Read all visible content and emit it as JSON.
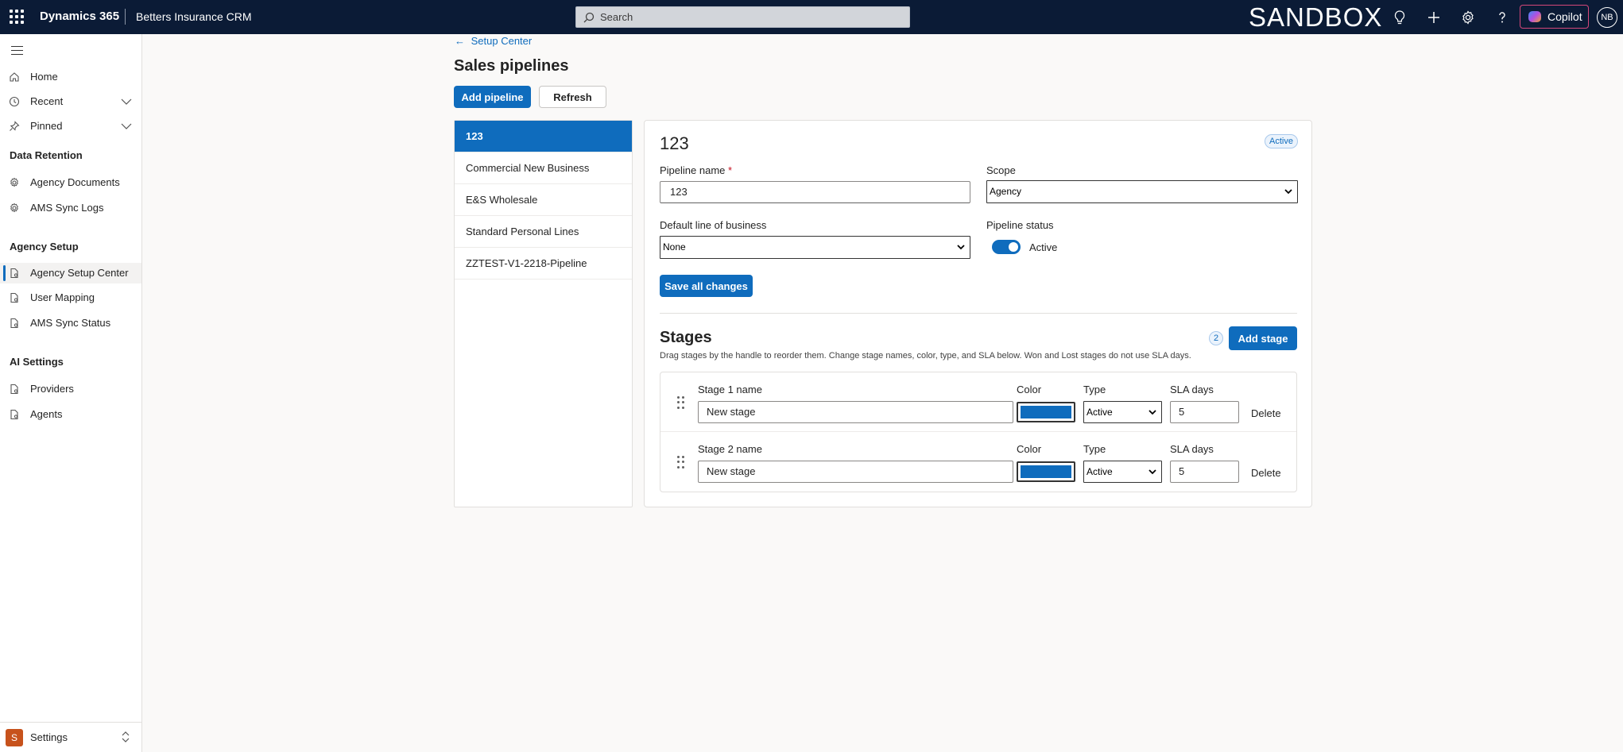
{
  "topbar": {
    "brand": "Dynamics 365",
    "app_name": "Betters Insurance CRM",
    "search_placeholder": "Search",
    "env_label": "SANDBOX",
    "copilot_label": "Copilot",
    "user_initials": "NB"
  },
  "sidebar": {
    "items_top": [
      {
        "label": "Home",
        "icon": "home-icon"
      },
      {
        "label": "Recent",
        "icon": "clock-icon"
      },
      {
        "label": "Pinned",
        "icon": "pin-icon"
      }
    ],
    "groups": [
      {
        "title": "Data Retention",
        "items": [
          "Agency Documents",
          "AMS Sync Logs"
        ]
      },
      {
        "title": "Agency Setup",
        "items": [
          "Agency Setup Center",
          "User Mapping",
          "AMS Sync Status"
        ]
      },
      {
        "title": "AI Settings",
        "items": [
          "Providers",
          "Agents"
        ]
      }
    ],
    "selected_item": "Agency Setup Center",
    "area_initial": "S",
    "area_label": "Settings"
  },
  "main": {
    "back_label": "Setup Center",
    "title": "Sales pipelines",
    "add_pipeline_label": "Add pipeline",
    "refresh_label": "Refresh",
    "pipelines": [
      "123",
      "Commercial New Business",
      "E&S Wholesale",
      "Standard Personal Lines",
      "ZZTEST-V1-2218-Pipeline"
    ],
    "selected_pipeline": "123"
  },
  "detail": {
    "title": "123",
    "status_badge": "Active",
    "pipeline_name_label": "Pipeline name",
    "required_mark": "*",
    "pipeline_name_value": "123",
    "scope_label": "Scope",
    "scope_value": "Agency",
    "lob_label": "Default line of business",
    "lob_value": "None",
    "status_label": "Pipeline status",
    "status_value": "Active",
    "save_label": "Save all changes",
    "stages_title": "Stages",
    "stages_desc": "Drag stages by the handle to reorder them. Change stage names, color, type, and SLA below. Won and Lost stages do not use SLA days.",
    "stage_count": "2",
    "add_stage_label": "Add stage",
    "stages": [
      {
        "name_label": "Stage 1 name",
        "name_value": "New stage",
        "color_label": "Color",
        "color": "#0f6cbd",
        "type_label": "Type",
        "type_value": "Active",
        "sla_label": "SLA days",
        "sla_value": "5",
        "delete_label": "Delete"
      },
      {
        "name_label": "Stage 2 name",
        "name_value": "New stage",
        "color_label": "Color",
        "color": "#0f6cbd",
        "type_label": "Type",
        "type_value": "Active",
        "sla_label": "SLA days",
        "sla_value": "5",
        "delete_label": "Delete"
      }
    ]
  },
  "colors": {
    "topbar_bg": "#0b1b36",
    "accent": "#0f6cbd",
    "area_badge": "#c7521c"
  }
}
